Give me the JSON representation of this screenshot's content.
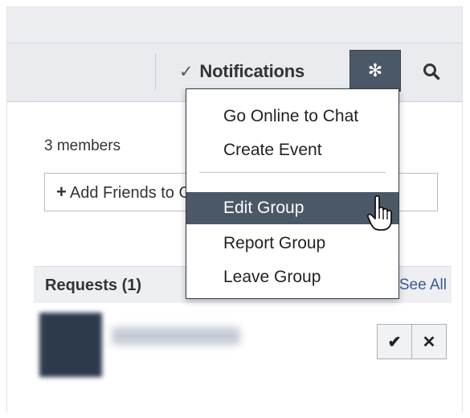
{
  "toolbar": {
    "notifications_label": "Notifications",
    "check_icon": "✓",
    "gear_icon": "✻"
  },
  "group": {
    "members_label": "3 members",
    "add_friends_label": "Add Friends to Group",
    "add_friends_icon": "+"
  },
  "requests": {
    "title": "Requests (1)",
    "see_all": "See All",
    "approve_icon": "✔",
    "decline_icon": "✕"
  },
  "menu": {
    "items": [
      {
        "label": "Go Online to Chat"
      },
      {
        "label": "Create Event"
      },
      {
        "label": "Edit Group"
      },
      {
        "label": "Report Group"
      },
      {
        "label": "Leave Group"
      }
    ],
    "highlighted": "Edit Group"
  },
  "colors": {
    "highlight": "#4b5866",
    "toolbar_bg": "#e9ebef",
    "link": "#3b5998"
  }
}
